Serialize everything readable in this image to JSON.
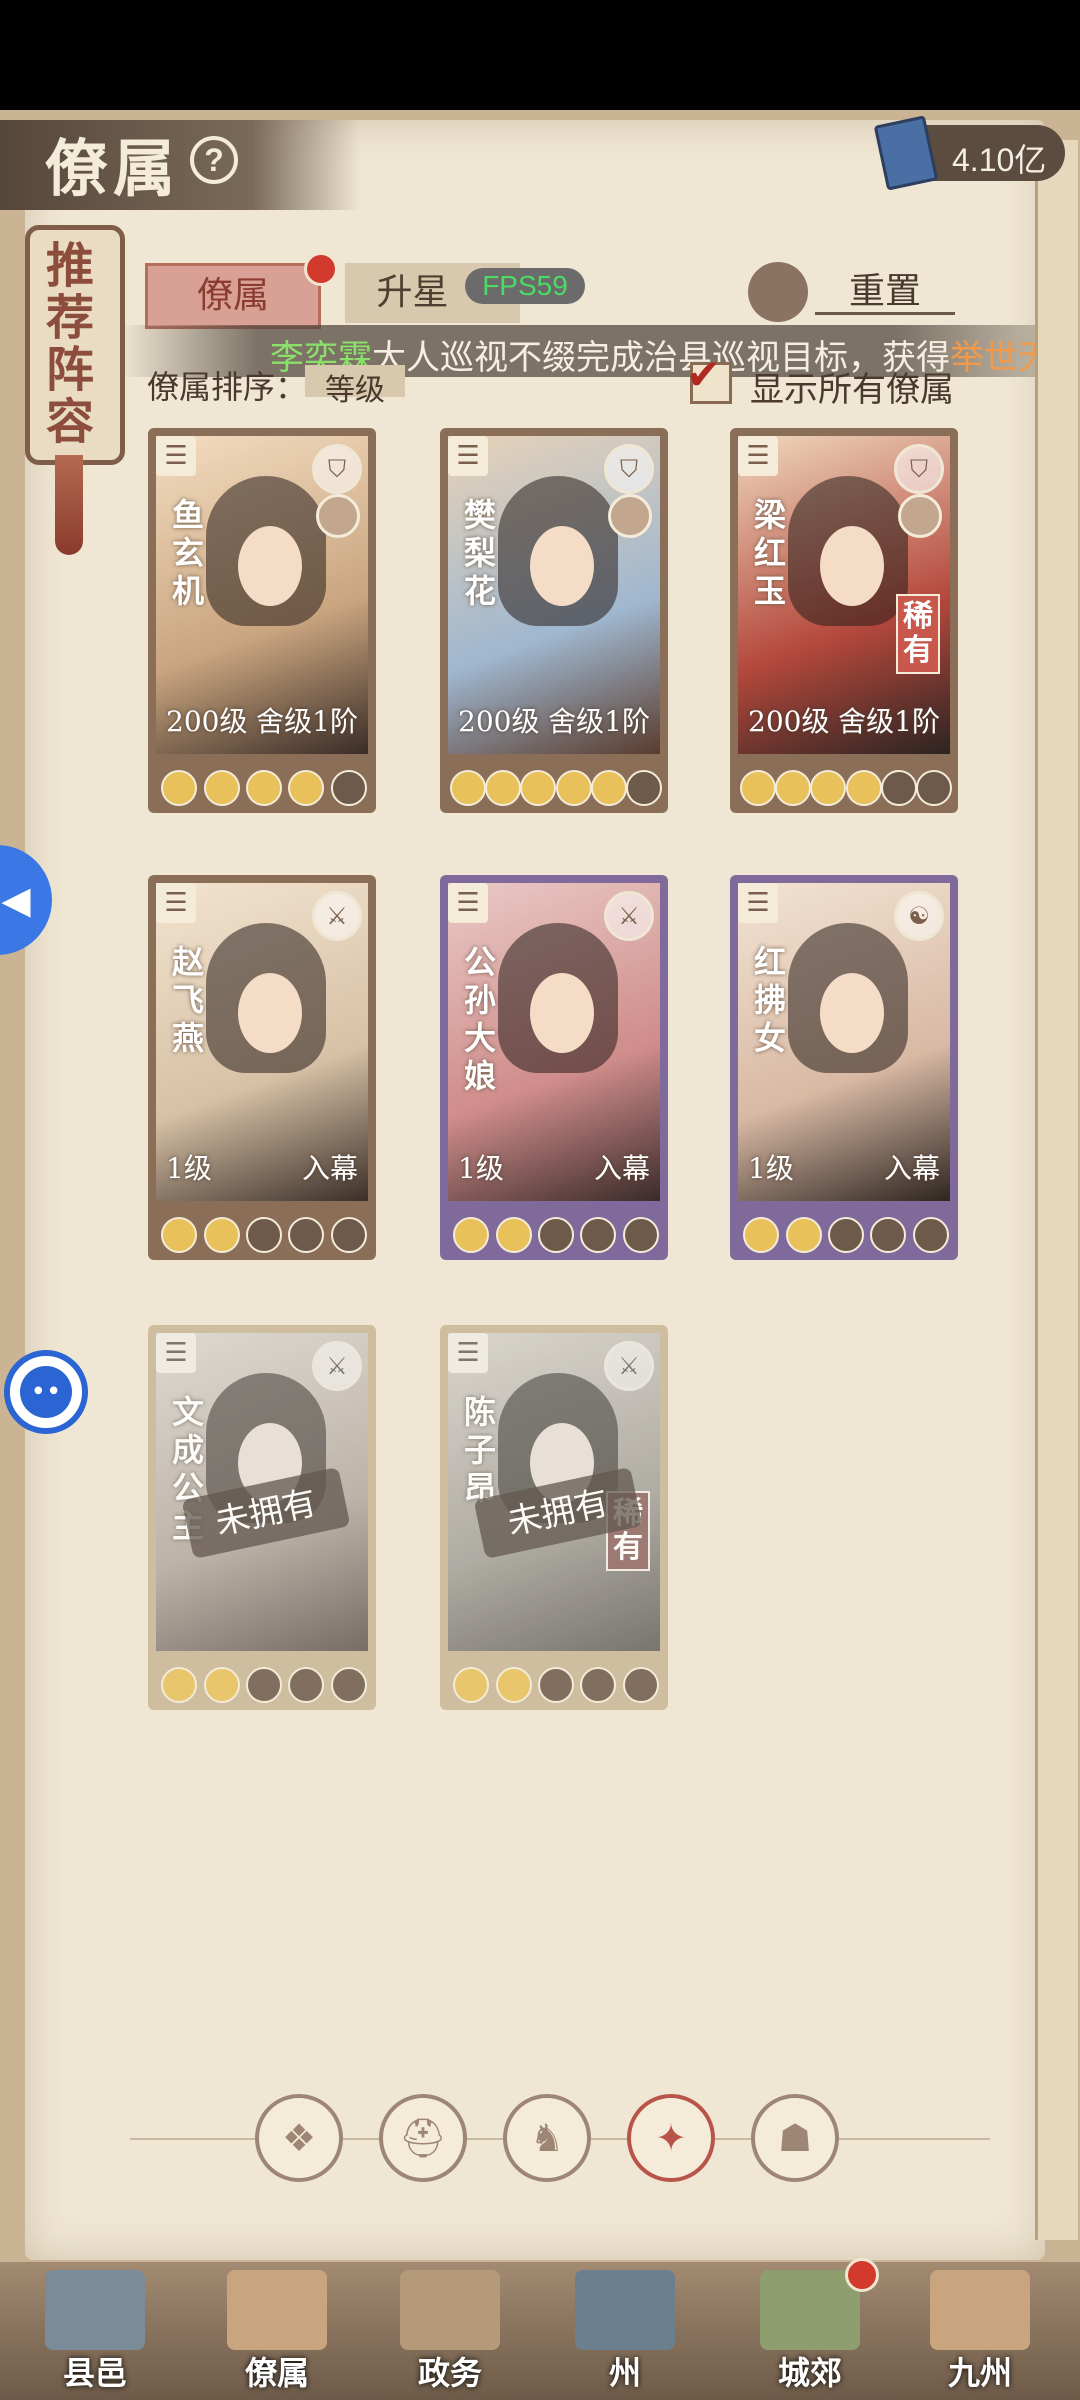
{
  "header": {
    "title": "僚属",
    "help_icon": "question-circle-icon",
    "currency_value": "4.10亿",
    "currency_icon": "book-icon"
  },
  "recommend": {
    "label": "推荐阵容"
  },
  "tabs": [
    {
      "label": "僚属",
      "active": true
    },
    {
      "label": "升星",
      "active": false
    }
  ],
  "fps": "FPS59",
  "reset_label": "重置",
  "marquee": {
    "name": "李奕霖",
    "body": "大人巡视不缀完成治县巡视目标，获得",
    "reward": "举世无"
  },
  "sort": {
    "label": "僚属排序：",
    "value": "等级"
  },
  "show_all": {
    "label": "显示所有僚属",
    "checked": true
  },
  "cards": [
    {
      "name": "鱼玄机",
      "level": "200级",
      "stage": "舍级1阶",
      "rare": "",
      "frame": "wood",
      "owned": true,
      "stars": 4,
      "slots": 5,
      "unowned_label": ""
    },
    {
      "name": "樊梨花",
      "level": "200级",
      "stage": "舍级1阶",
      "rare": "",
      "frame": "wood",
      "owned": true,
      "stars": 5,
      "slots": 6,
      "unowned_label": ""
    },
    {
      "name": "梁红玉",
      "level": "200级",
      "stage": "舍级1阶",
      "rare": "稀有",
      "frame": "wood",
      "owned": true,
      "stars": 4,
      "slots": 6,
      "unowned_label": ""
    },
    {
      "name": "赵飞燕",
      "level": "1级",
      "stage": "入幕",
      "rare": "",
      "frame": "wood",
      "owned": true,
      "stars": 2,
      "slots": 5,
      "unowned_label": ""
    },
    {
      "name": "公孙大娘",
      "level": "1级",
      "stage": "入幕",
      "rare": "",
      "frame": "purple",
      "owned": true,
      "stars": 2,
      "slots": 5,
      "unowned_label": ""
    },
    {
      "name": "红拂女",
      "level": "1级",
      "stage": "入幕",
      "rare": "",
      "frame": "purple",
      "owned": true,
      "stars": 2,
      "slots": 5,
      "unowned_label": ""
    },
    {
      "name": "文成公主",
      "level": "",
      "stage": "",
      "rare": "",
      "frame": "locked",
      "owned": false,
      "stars": 2,
      "slots": 5,
      "unowned_label": "未拥有"
    },
    {
      "name": "陈子昂",
      "level": "",
      "stage": "",
      "rare": "稀有",
      "frame": "locked",
      "owned": false,
      "stars": 2,
      "slots": 5,
      "unowned_label": "未拥有"
    }
  ],
  "category_icons": [
    "diamond-icon",
    "helmet-icon",
    "horse-icon",
    "fan-icon",
    "mask-icon"
  ],
  "bottom_tabs": [
    {
      "label": "县邑",
      "icon": "city-gate-icon",
      "badge": false
    },
    {
      "label": "僚属",
      "icon": "scroll-portrait-icon",
      "badge": false
    },
    {
      "label": "政务",
      "icon": "document-seal-icon",
      "badge": false
    },
    {
      "label": "州",
      "icon": "mountain-pavilion-icon",
      "badge": false
    },
    {
      "label": "城郊",
      "icon": "countryside-icon",
      "badge": true
    },
    {
      "label": "九州",
      "icon": "map-scroll-icon",
      "badge": false
    }
  ],
  "colors": {
    "accent_red": "#b9544a",
    "gold_star": "#e8c15a",
    "empty_slot": "#6e5a4a",
    "purple_frame": "#806a9c"
  }
}
